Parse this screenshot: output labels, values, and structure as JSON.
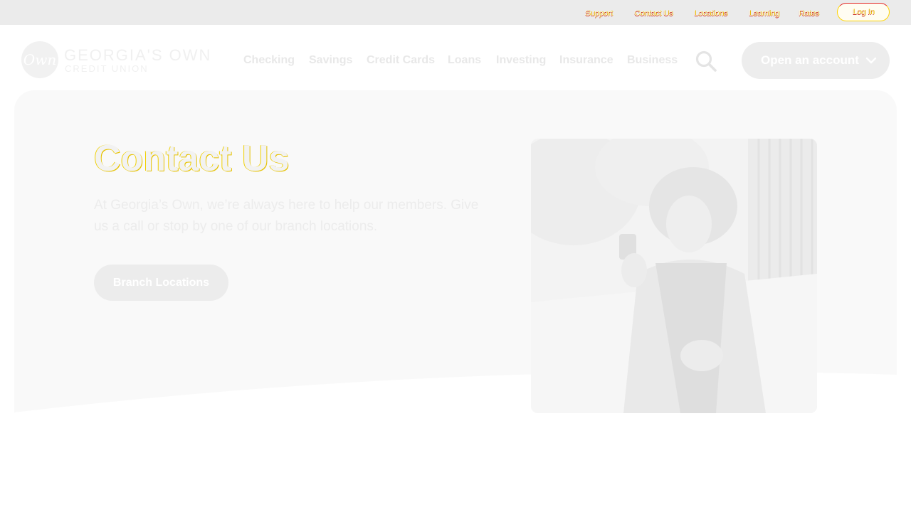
{
  "utility_nav": {
    "links": [
      "Support",
      "Contact Us",
      "Locations",
      "Learning",
      "Rates"
    ],
    "login_label": "Log In"
  },
  "header": {
    "logo": {
      "mark": "Own",
      "line1": "GEORGIA'S OWN",
      "line2": "CREDIT UNION"
    },
    "nav_items": [
      "Checking",
      "Savings",
      "Credit Cards",
      "Loans",
      "Investing",
      "Insurance",
      "Business"
    ],
    "search_icon": "search-icon",
    "open_account_label": "Open an account"
  },
  "hero": {
    "title": "Contact Us",
    "description": "At Georgia’s Own, we’re always here to help our members. Give us a call or stop by one of our branch locations.",
    "button_label": "Branch Locations",
    "image_alt": "Woman looking at her phone on a sidewalk"
  },
  "colors": {
    "utility_bar": "#ebebeb",
    "hero_background": "#f9f9f9",
    "button_fill": "#ececec",
    "accent_yellow": "#ffd400",
    "accent_red": "#e02020"
  }
}
